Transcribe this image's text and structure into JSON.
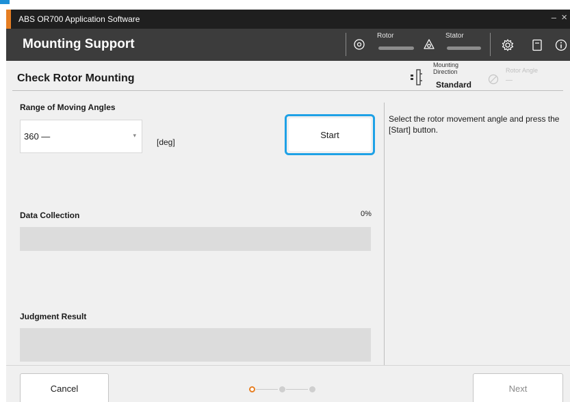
{
  "window": {
    "title": "ABS OR700 Application Software",
    "minimize": "–",
    "close": "×"
  },
  "header": {
    "title": "Mounting Support",
    "rotor_label": "Rotor",
    "stator_label": "Stator",
    "icons": [
      "rotor-icon",
      "stator-icon",
      "settings-icon",
      "manual-icon",
      "info-icon"
    ]
  },
  "page": {
    "title": "Check Rotor Mounting",
    "mounting_direction_label_1": "Mounting",
    "mounting_direction_label_2": "Direction",
    "mounting_direction_value": "Standard",
    "rotor_angle_label": "Rotor Angle",
    "rotor_angle_value": "—"
  },
  "form": {
    "range_label": "Range of Moving Angles",
    "range_value": "360 —",
    "unit": "[deg]",
    "start_label": "Start",
    "data_collection_label": "Data Collection",
    "progress_percent": "0%",
    "progress_fraction": 0,
    "judgment_label": "Judgment Result"
  },
  "instructions": "Select the rotor movement angle and press the [Start] button.",
  "footer": {
    "cancel_label": "Cancel",
    "next_label": "Next",
    "steps_total": 3,
    "step_current": 1
  },
  "colors": {
    "accent_blue": "#1ea1e6",
    "title_accent": "#e67e22",
    "step_active": "#e67e22"
  }
}
